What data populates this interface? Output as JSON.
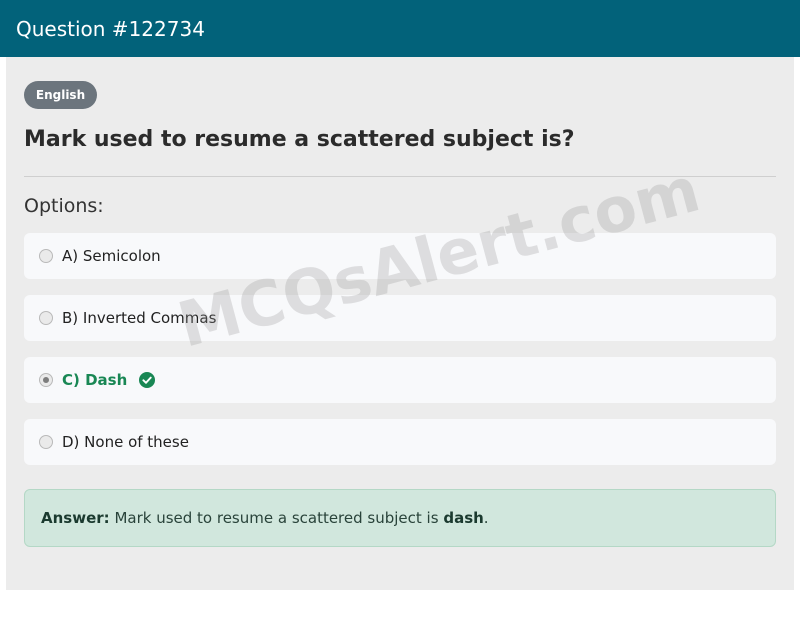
{
  "header": {
    "title": "Question #122734"
  },
  "badge": {
    "label": "English"
  },
  "question": {
    "text": "Mark used to resume a scattered subject is?"
  },
  "options_label": "Options:",
  "options": [
    {
      "text": "A) Semicolon",
      "selected": false,
      "correct": false
    },
    {
      "text": "B) Inverted Commas",
      "selected": false,
      "correct": false
    },
    {
      "text": "C) Dash",
      "selected": true,
      "correct": true
    },
    {
      "text": "D) None of these",
      "selected": false,
      "correct": false
    }
  ],
  "answer": {
    "label": "Answer:",
    "text": "Mark used to resume a scattered subject is",
    "value": "dash",
    "end": "."
  },
  "watermark": "MCQsAlert.com",
  "colors": {
    "header": "#02627a",
    "correct": "#198754",
    "answer_bg": "#d1e7dd"
  }
}
